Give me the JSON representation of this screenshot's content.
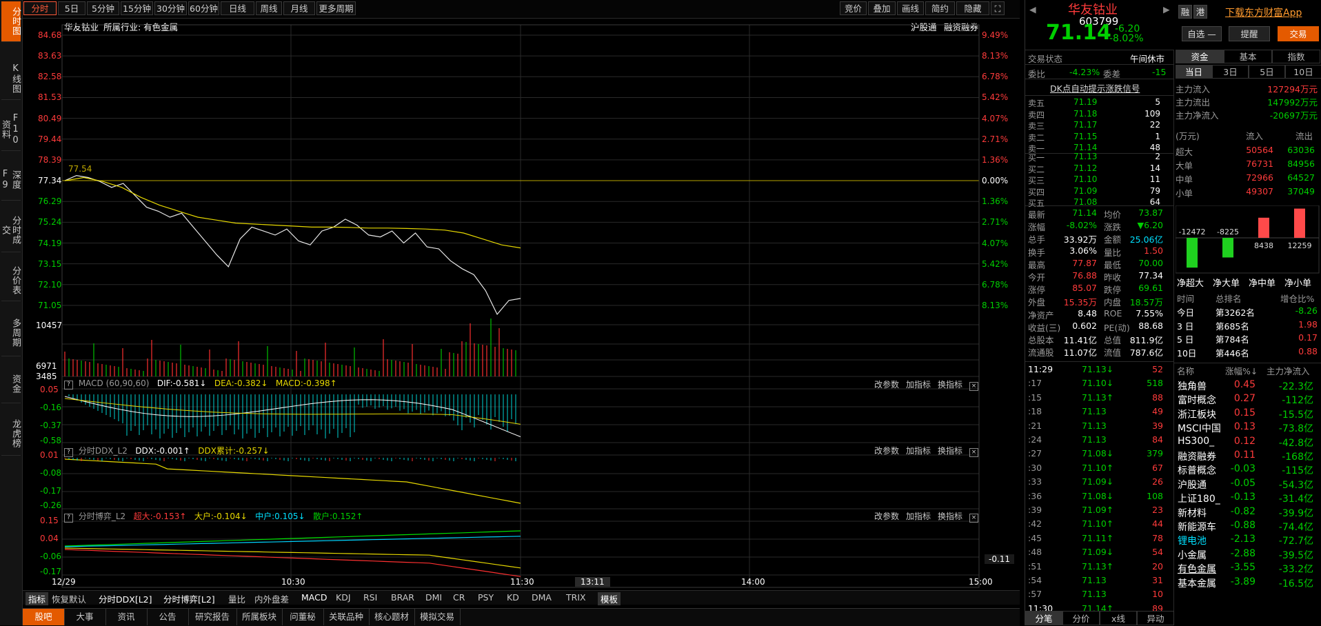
{
  "sidebar": [
    "分时图",
    "K线图",
    "F10资料",
    "深度F9",
    "分时成交",
    "分价表",
    "多周期",
    "资金",
    "龙虎榜"
  ],
  "toolbar": {
    "periods": [
      "分时",
      "5日",
      "5分钟",
      "15分钟",
      "30分钟",
      "60分钟",
      "日线",
      "周线",
      "月线",
      "更多周期"
    ],
    "right": [
      "竞价",
      "叠加",
      "画线",
      "简约",
      "隐藏"
    ]
  },
  "main": {
    "stock": "华友钴业",
    "industry": "所属行业: 有色金属",
    "links": [
      "沪股通",
      "融资融券"
    ],
    "price_labels": [
      "84.68",
      "83.63",
      "82.58",
      "81.53",
      "80.49",
      "79.44",
      "78.39",
      "77.34",
      "76.29",
      "75.24",
      "74.19",
      "73.15",
      "72.10",
      "71.05"
    ],
    "pct_labels": [
      "9.49%",
      "8.13%",
      "6.78%",
      "5.42%",
      "4.07%",
      "2.71%",
      "1.36%",
      "0.00%",
      "1.36%",
      "2.71%",
      "4.07%",
      "5.42%",
      "6.78%",
      "8.13%"
    ],
    "high_mark": "77.54",
    "vol_labels": [
      "10457",
      "6971",
      "3485"
    ],
    "macd": {
      "title": "MACD (60,90,60)",
      "dif": "DIF:-0.581↓",
      "dea": "DEA:-0.382↓",
      "macd": "MACD:-0.398↑",
      "labels": [
        "0.05",
        "-0.16",
        "-0.37",
        "-0.58"
      ]
    },
    "ddx": {
      "title": "分时DDX_L2",
      "ddx": "DDX:-0.001↑",
      "sum": "DDX累计:-0.257↓",
      "labels": [
        "0.01",
        "-0.08",
        "-0.17",
        "-0.26"
      ]
    },
    "game": {
      "title": "分时博弈_L2",
      "sup": "超大:-0.153↑",
      "big": "大户:-0.104↓",
      "mid": "中户:0.105↓",
      "small": "散户:0.152↑",
      "labels": [
        "0.15",
        "0.04",
        "-0.06",
        "-0.17"
      ],
      "right_val": "-0.11"
    },
    "tools": [
      "改参数",
      "加指标",
      "换指标"
    ],
    "time_axis": [
      "12/29",
      "10:30",
      "11:30",
      "13:11",
      "14:00",
      "15:00"
    ],
    "indicators": [
      "指标",
      "恢复默认",
      "分时DDX[L2]",
      "分时博弈[L2]",
      "量比",
      "内外盘差",
      "MACD",
      "KDJ",
      "RSI",
      "BRAR",
      "DMI",
      "CR",
      "PSY",
      "KD",
      "DMA",
      "TRIX",
      "模板"
    ],
    "news_tabs": [
      "股吧",
      "大事",
      "资讯",
      "公告",
      "研究报告",
      "所属板块",
      "问董秘",
      "关联品种",
      "核心题材",
      "模拟交易"
    ]
  },
  "right": {
    "name": "华友钴业",
    "code": "603799",
    "price": "71.14",
    "change": "-6.20",
    "change_pct": "-8.02%",
    "badges": [
      "融",
      "港"
    ],
    "download": "下载东方财富App",
    "btn_self": "自选 —",
    "btn_alert": "提醒",
    "btn_trade": "交易",
    "status_label": "交易状态",
    "status_val": "午间休市",
    "weibi": "委比",
    "weibi_val": "-4.23%",
    "weicha": "委差",
    "weicha_val": "-15",
    "dk": "DK点自动提示涨跌信号",
    "asks": [
      [
        "卖五",
        "71.19",
        "5"
      ],
      [
        "卖四",
        "71.18",
        "109"
      ],
      [
        "卖三",
        "71.17",
        "22"
      ],
      [
        "卖二",
        "71.15",
        "1"
      ],
      [
        "卖一",
        "71.14",
        "48"
      ]
    ],
    "bids": [
      [
        "买一",
        "71.13",
        "2"
      ],
      [
        "买二",
        "71.12",
        "14"
      ],
      [
        "买三",
        "71.10",
        "11"
      ],
      [
        "买四",
        "71.09",
        "79"
      ],
      [
        "买五",
        "71.08",
        "64"
      ]
    ],
    "stats": [
      [
        "最新",
        "71.14",
        "均价",
        "73.87"
      ],
      [
        "涨幅",
        "-8.02%",
        "涨跌",
        "▼6.20"
      ],
      [
        "总手",
        "33.92万",
        "金额",
        "25.06亿"
      ],
      [
        "换手",
        "3.06%",
        "量比",
        "1.50"
      ],
      [
        "最高",
        "77.87",
        "最低",
        "70.00"
      ],
      [
        "今开",
        "76.88",
        "昨收",
        "77.34"
      ],
      [
        "涨停",
        "85.07",
        "跌停",
        "69.61"
      ],
      [
        "外盘",
        "15.35万",
        "内盘",
        "18.57万"
      ],
      [
        "净资产",
        "8.48",
        "ROE",
        "7.55%"
      ],
      [
        "收益(三)",
        "0.602",
        "PE(动)",
        "88.68"
      ],
      [
        "总股本",
        "11.41亿",
        "总值",
        "811.9亿"
      ],
      [
        "流通股",
        "11.07亿",
        "流值",
        "787.6亿"
      ]
    ],
    "ticks": [
      [
        "11:29",
        "71.13↓",
        "52"
      ],
      [
        ":17",
        "71.10↓",
        "518"
      ],
      [
        ":15",
        "71.13↑",
        "88"
      ],
      [
        ":18",
        "71.13",
        "49"
      ],
      [
        ":21",
        "71.13",
        "39"
      ],
      [
        ":24",
        "71.13",
        "84"
      ],
      [
        ":27",
        "71.08↓",
        "379"
      ],
      [
        ":30",
        "71.10↑",
        "67"
      ],
      [
        ":33",
        "71.09↓",
        "26"
      ],
      [
        ":36",
        "71.08↓",
        "108"
      ],
      [
        ":39",
        "71.09↑",
        "23"
      ],
      [
        ":42",
        "71.10↑",
        "44"
      ],
      [
        ":45",
        "71.11↑",
        "78"
      ],
      [
        ":48",
        "71.09↓",
        "54"
      ],
      [
        ":51",
        "71.13↑",
        "20"
      ],
      [
        ":54",
        "71.13",
        "31"
      ],
      [
        ":57",
        "71.13",
        "10"
      ],
      [
        "11:30",
        "71.14↑",
        "89"
      ]
    ],
    "tick_tabs": [
      "分笔",
      "分价",
      "x线",
      "异动"
    ],
    "fund_tabs": [
      "资金",
      "基本",
      "指数"
    ],
    "period_tabs": [
      "当日",
      "3日",
      "5日",
      "10日"
    ],
    "flow": [
      [
        "主力流入",
        "127294万元"
      ],
      [
        "主力流出",
        "147992万元"
      ],
      [
        "主力净流入",
        "-20697万元"
      ]
    ],
    "flow_hdr": [
      "(万元)",
      "流入",
      "流出"
    ],
    "flow_rows": [
      [
        "超大",
        "50564",
        "63036"
      ],
      [
        "大单",
        "76731",
        "84956"
      ],
      [
        "中单",
        "72966",
        "64527"
      ],
      [
        "小单",
        "49307",
        "37049"
      ]
    ],
    "bars": {
      "values": [
        -12472,
        -8225,
        8438,
        12259
      ],
      "labels": [
        "-12472",
        "-8225",
        "8438",
        "12259"
      ],
      "names": [
        "净超大",
        "净大单",
        "净中单",
        "净小单"
      ]
    },
    "rank_hdr": [
      "时间",
      "总排名",
      "增仓比%"
    ],
    "ranks": [
      [
        "今日",
        "第3262名",
        "-8.26"
      ],
      [
        "3 日",
        "第685名",
        "1.98"
      ],
      [
        "5 日",
        "第784名",
        "0.17"
      ],
      [
        "10日",
        "第446名",
        "0.88"
      ]
    ],
    "sector_hdr": [
      "名称",
      "涨幅%↓",
      "主力净流入"
    ],
    "sectors": [
      [
        "独角兽",
        "0.45",
        "-22.3亿"
      ],
      [
        "富时概念",
        "0.27",
        "-112亿"
      ],
      [
        "浙江板块",
        "0.15",
        "-15.5亿"
      ],
      [
        "MSCI中国",
        "0.13",
        "-73.8亿"
      ],
      [
        "HS300_",
        "0.12",
        "-42.8亿"
      ],
      [
        "融资融券",
        "0.11",
        "-168亿"
      ],
      [
        "标普概念",
        "-0.03",
        "-115亿"
      ],
      [
        "沪股通",
        "-0.05",
        "-54.3亿"
      ],
      [
        "上证180_",
        "-0.13",
        "-31.4亿"
      ],
      [
        "新材料",
        "-0.82",
        "-39.9亿"
      ],
      [
        "新能源车",
        "-0.88",
        "-74.4亿"
      ],
      [
        "锂电池",
        "-2.13",
        "-72.7亿"
      ],
      [
        "小金属",
        "-2.88",
        "-39.5亿"
      ],
      [
        "有色金属",
        "-3.55",
        "-33.2亿"
      ],
      [
        "基本金属",
        "-3.89",
        "-16.5亿"
      ]
    ]
  }
}
